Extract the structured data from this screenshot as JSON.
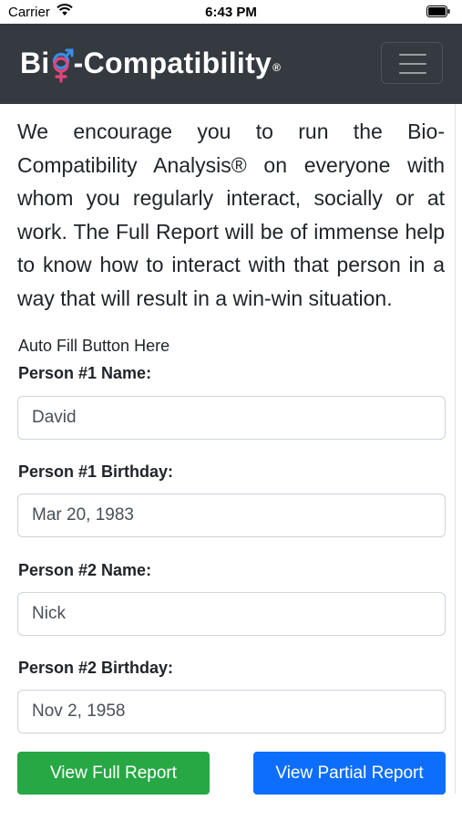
{
  "status_bar": {
    "carrier": "Carrier",
    "time": "6:43 PM"
  },
  "navbar": {
    "brand_prefix": "Bi",
    "brand_suffix": "-Compatibility",
    "brand_mark": "®",
    "menu_icon": "hamburger-menu-icon",
    "color": "#343a40"
  },
  "intro_text": "We encourage you to run the Bio-Compatibility Analysis® on everyone with whom you regularly interact, socially or at work. The Full Report will be of immense help to know how to interact with that person in a way that will result in a win-win situation.",
  "autofill_text": "Auto Fill Button Here",
  "form": {
    "person1_name_label": "Person #1 Name:",
    "person1_name_value": "David",
    "person1_birthday_label": "Person #1 Birthday:",
    "person1_birthday_value": "Mar 20, 1983",
    "person2_name_label": "Person #2 Name:",
    "person2_name_value": "Nick",
    "person2_birthday_label": "Person #2 Birthday:",
    "person2_birthday_value": "Nov 2, 1958"
  },
  "buttons": {
    "full_report": "View Full Report",
    "partial_report": "View Partial Report",
    "full_color": "#28a745",
    "partial_color": "#0d6efd"
  }
}
